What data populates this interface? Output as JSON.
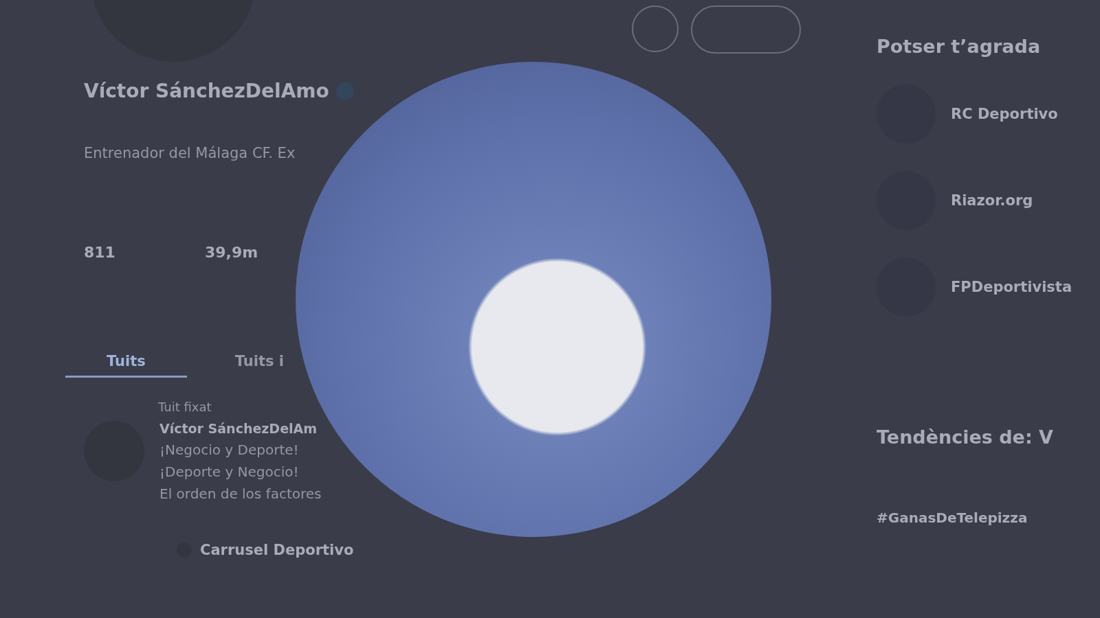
{
  "profile": {
    "name": "Víctor SánchezDelAmo",
    "bio": "Entrenador del Málaga CF. Ex",
    "stats": [
      "811",
      "39,9m"
    ]
  },
  "tabs": [
    {
      "label": "Tuits",
      "selected": true
    },
    {
      "label": "Tuits i",
      "selected": false
    }
  ],
  "pinned_tweet": {
    "label": "Tuit fixat",
    "author": "Víctor SánchezDelAm",
    "lines": [
      "¡Negocio y Deporte!",
      "¡Deporte y Negocio!",
      "El orden de los factores"
    ]
  },
  "retweet": {
    "author": "Carrusel Deportivo"
  },
  "suggestions": {
    "title": "Potser t’agrada",
    "items": [
      {
        "name": "RC Deportivo"
      },
      {
        "name": "Riazor.org"
      },
      {
        "name": "FPDeportivista"
      }
    ]
  },
  "trends": {
    "title": "Tendències de: V",
    "items": [
      {
        "tag": "#GanasDeTelepizza"
      }
    ]
  }
}
